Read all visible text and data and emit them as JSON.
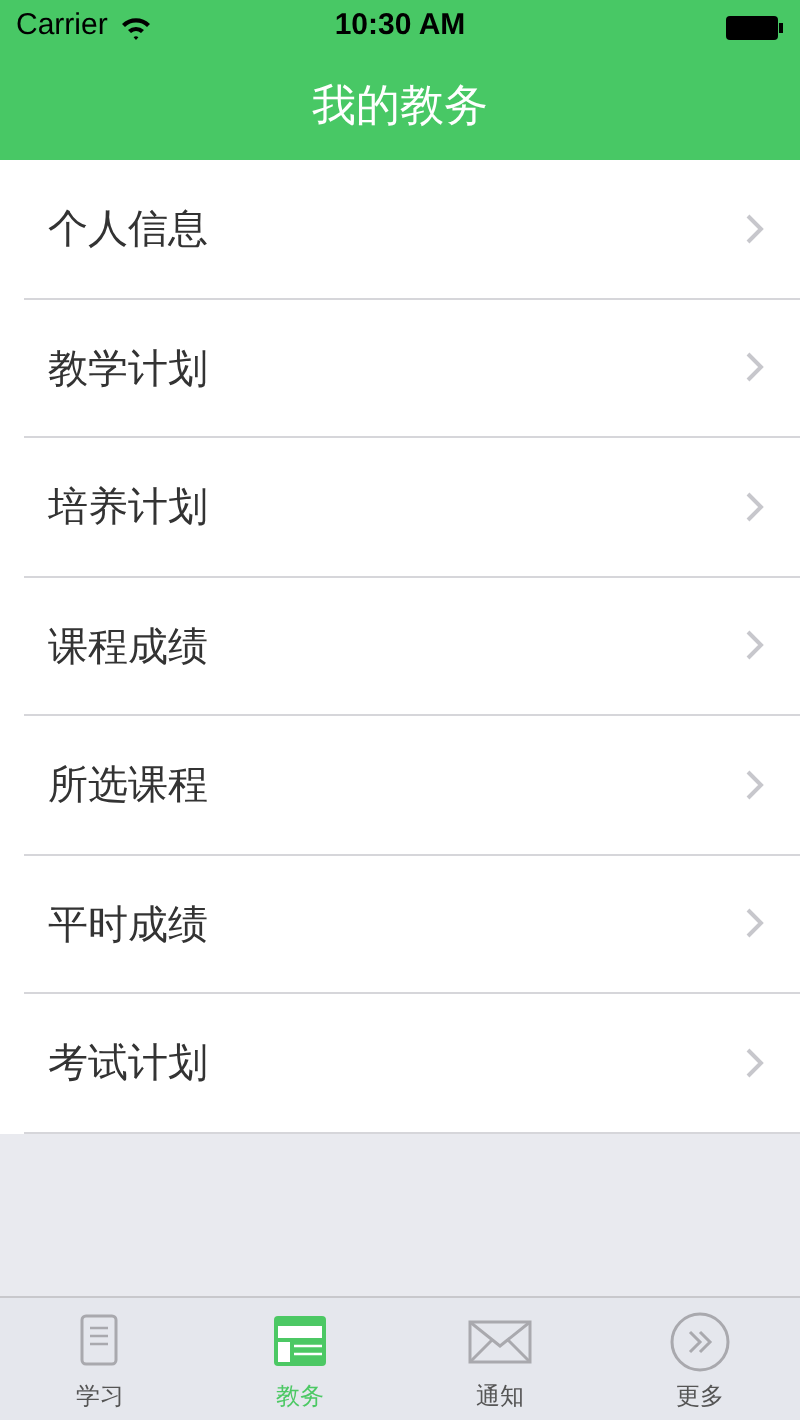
{
  "status_bar": {
    "carrier": "Carrier",
    "time": "10:30 AM"
  },
  "nav_bar": {
    "title": "我的教务"
  },
  "menu_items": [
    {
      "label": "个人信息"
    },
    {
      "label": "教学计划"
    },
    {
      "label": "培养计划"
    },
    {
      "label": "课程成绩"
    },
    {
      "label": "所选课程"
    },
    {
      "label": "平时成绩"
    },
    {
      "label": "考试计划"
    }
  ],
  "tab_bar": [
    {
      "label": "学习",
      "kind": "document",
      "selected": false
    },
    {
      "label": "教务",
      "kind": "browser",
      "selected": true
    },
    {
      "label": "通知",
      "kind": "mail",
      "selected": false
    },
    {
      "label": "更多",
      "kind": "more",
      "selected": false
    }
  ]
}
